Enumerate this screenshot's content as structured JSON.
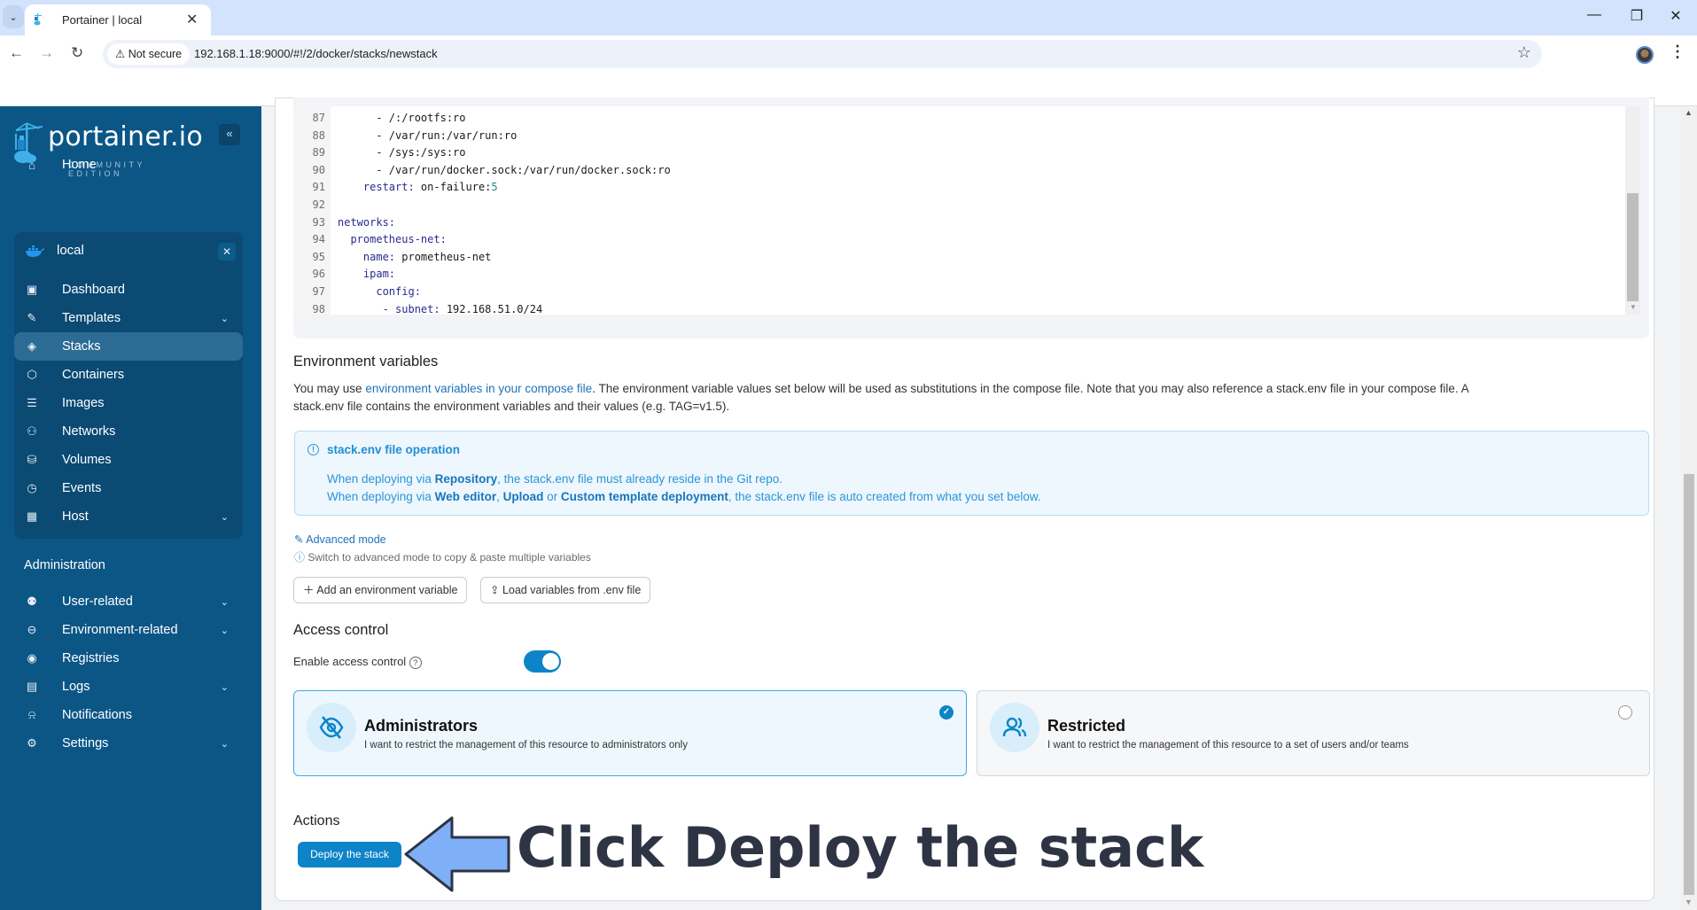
{
  "browser": {
    "tab_title": "Portainer | local",
    "not_secure_label": "Not secure",
    "url": "192.168.1.18:9000/#!/2/docker/stacks/newstack"
  },
  "sidebar": {
    "logo_text": "portainer.io",
    "logo_subtitle": "COMMUNITY EDITION",
    "home_label": "Home",
    "environment_name": "local",
    "env_items": [
      {
        "label": "Dashboard",
        "icon": "dashboard-icon",
        "has_chevron": false
      },
      {
        "label": "Templates",
        "icon": "edit-icon",
        "has_chevron": true
      },
      {
        "label": "Stacks",
        "icon": "layers-icon",
        "has_chevron": false,
        "active": true
      },
      {
        "label": "Containers",
        "icon": "box-icon",
        "has_chevron": false
      },
      {
        "label": "Images",
        "icon": "list-icon",
        "has_chevron": false
      },
      {
        "label": "Networks",
        "icon": "network-icon",
        "has_chevron": false
      },
      {
        "label": "Volumes",
        "icon": "database-icon",
        "has_chevron": false
      },
      {
        "label": "Events",
        "icon": "clock-icon",
        "has_chevron": false
      },
      {
        "label": "Host",
        "icon": "host-icon",
        "has_chevron": true
      }
    ],
    "admin_heading": "Administration",
    "admin_items": [
      {
        "label": "User-related",
        "icon": "users-icon",
        "has_chevron": true
      },
      {
        "label": "Environment-related",
        "icon": "drive-icon",
        "has_chevron": true
      },
      {
        "label": "Registries",
        "icon": "radio-icon",
        "has_chevron": false
      },
      {
        "label": "Logs",
        "icon": "file-icon",
        "has_chevron": true
      },
      {
        "label": "Notifications",
        "icon": "bell-icon",
        "has_chevron": false
      },
      {
        "label": "Settings",
        "icon": "gear-icon",
        "has_chevron": true
      }
    ]
  },
  "editor": {
    "lines": [
      {
        "n": "87",
        "text": "      - /:/rootfs:ro"
      },
      {
        "n": "88",
        "text": "      - /var/run:/var/run:ro"
      },
      {
        "n": "89",
        "text": "      - /sys:/sys:ro"
      },
      {
        "n": "90",
        "text": "      - /var/run/docker.sock:/var/run/docker.sock:ro"
      },
      {
        "n": "91",
        "key": "    restart:",
        "text": " on-failure:",
        "num": "5"
      },
      {
        "n": "92",
        "text": ""
      },
      {
        "n": "93",
        "key": "networks:",
        "text": ""
      },
      {
        "n": "94",
        "key": "  prometheus-net:",
        "text": ""
      },
      {
        "n": "95",
        "key": "    name:",
        "text": " prometheus-net"
      },
      {
        "n": "96",
        "key": "    ipam:",
        "text": ""
      },
      {
        "n": "97",
        "key": "      config:",
        "text": ""
      },
      {
        "n": "98",
        "key": "       - subnet:",
        "text": " 192.168.51.0/24"
      }
    ]
  },
  "env_vars": {
    "heading": "Environment variables",
    "para_prefix": "You may use ",
    "para_link": "environment variables in your compose file",
    "para_suffix": ". The environment variable values set below will be used as substitutions in the compose file. Note that you may also reference a stack.env file in your compose file. A",
    "para_line2": "stack.env file contains the environment variables and their values (e.g. TAG=v1.5).",
    "info_title": "stack.env file operation",
    "info_line1_a": "When deploying via ",
    "info_line1_b": "Repository",
    "info_line1_c": ", the stack.env file must already reside in the Git repo.",
    "info_line2_a": "When deploying via ",
    "info_line2_b": "Web editor",
    "info_line2_c": ", ",
    "info_line2_d": "Upload",
    "info_line2_e": " or ",
    "info_line2_f": "Custom template deployment",
    "info_line2_g": ", the stack.env file is auto created from what you set below.",
    "advanced_mode_label": "Advanced mode",
    "advanced_note": "Switch to advanced mode to copy & paste multiple variables",
    "add_variable_label": "Add an environment variable",
    "load_env_label": "Load variables from .env file"
  },
  "access_control": {
    "heading": "Access control",
    "enable_label": "Enable access control",
    "enabled": true,
    "options": [
      {
        "title": "Administrators",
        "desc": "I want to restrict the management of this resource to administrators only",
        "selected": true
      },
      {
        "title": "Restricted",
        "desc": "I want to restrict the management of this resource to a set of users and/or teams",
        "selected": false
      }
    ]
  },
  "actions": {
    "heading": "Actions",
    "deploy_label": "Deploy the stack"
  },
  "annotation": {
    "text": "Click Deploy the stack"
  },
  "colors": {
    "sidebar_bg": "#0c5686",
    "accent": "#0d84c8",
    "annotation_arrow": "#7fb0f7"
  }
}
